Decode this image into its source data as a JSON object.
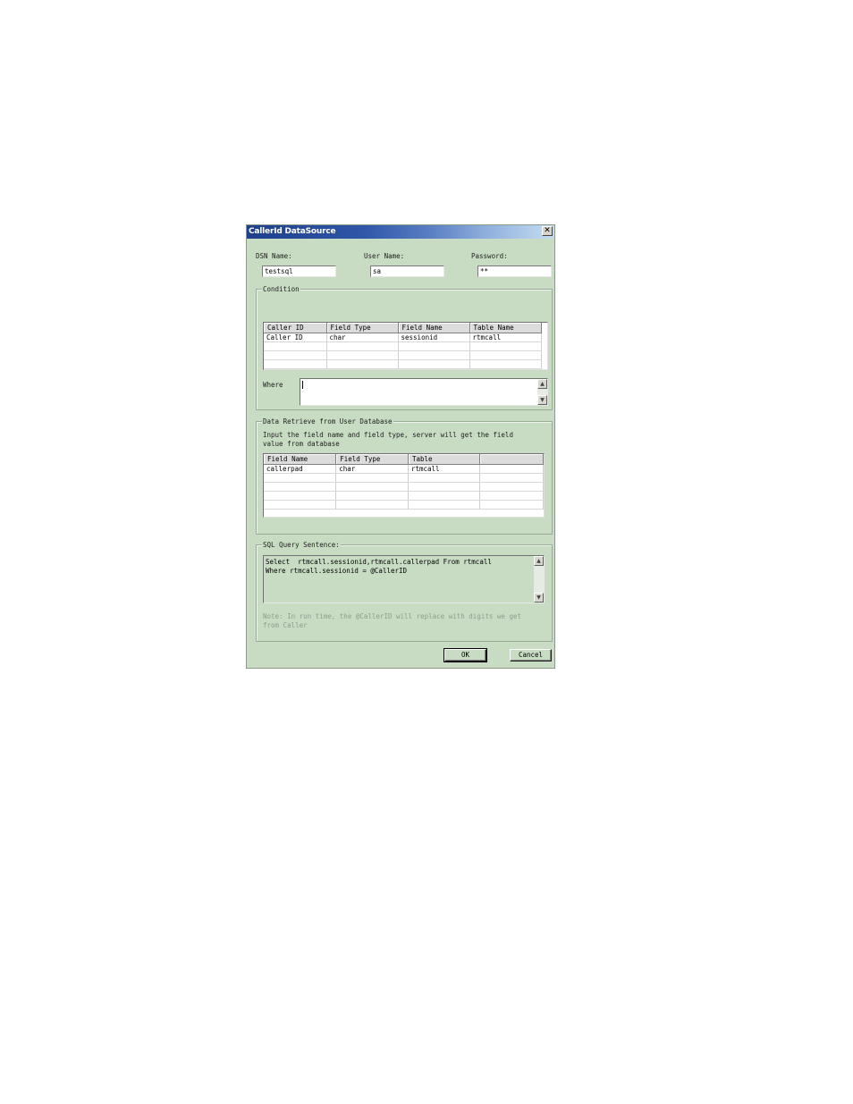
{
  "window": {
    "title": "CallerId DataSource",
    "close_glyph": "✕"
  },
  "dsn": {
    "label": "DSN Name:",
    "value": "testsql"
  },
  "user": {
    "label": "User Name:",
    "value": "sa"
  },
  "password": {
    "label": "Password:",
    "value": "**"
  },
  "condition": {
    "group_title": "Condition",
    "columns": [
      "Caller ID",
      "Field Type",
      "Field Name",
      "Table Name"
    ],
    "rows": [
      [
        "Caller ID",
        "char",
        "sessionid",
        "rtmcall"
      ],
      [
        "",
        "",
        "",
        ""
      ],
      [
        "",
        "",
        "",
        ""
      ],
      [
        "",
        "",
        "",
        ""
      ]
    ],
    "where_label": "Where",
    "where_value": ""
  },
  "retrieve": {
    "group_title": "Data Retrieve from User Database",
    "description_line1": "Input the field name and field type, server will get the field",
    "description_line2": "value from database",
    "columns": [
      "Field Name",
      "Field Type",
      "Table",
      ""
    ],
    "rows": [
      [
        "callerpad",
        "char",
        "rtmcall",
        ""
      ],
      [
        "",
        "",
        "",
        ""
      ],
      [
        "",
        "",
        "",
        ""
      ],
      [
        "",
        "",
        "",
        ""
      ],
      [
        "",
        "",
        "",
        ""
      ]
    ]
  },
  "sql": {
    "group_title": "SQL Query Sentence:",
    "line1": "Select  rtmcall.sessionid,rtmcall.callerpad From rtmcall",
    "line2": "Where rtmcall.sessionid = @CallerID",
    "note_line1": "Note: In run time, the @CallerID will replace with digits we get",
    "note_line2": "from Caller"
  },
  "buttons": {
    "ok": "OK",
    "cancel": "Cancel"
  },
  "icons": {
    "scroll_up": "▲",
    "scroll_down": "▼"
  }
}
